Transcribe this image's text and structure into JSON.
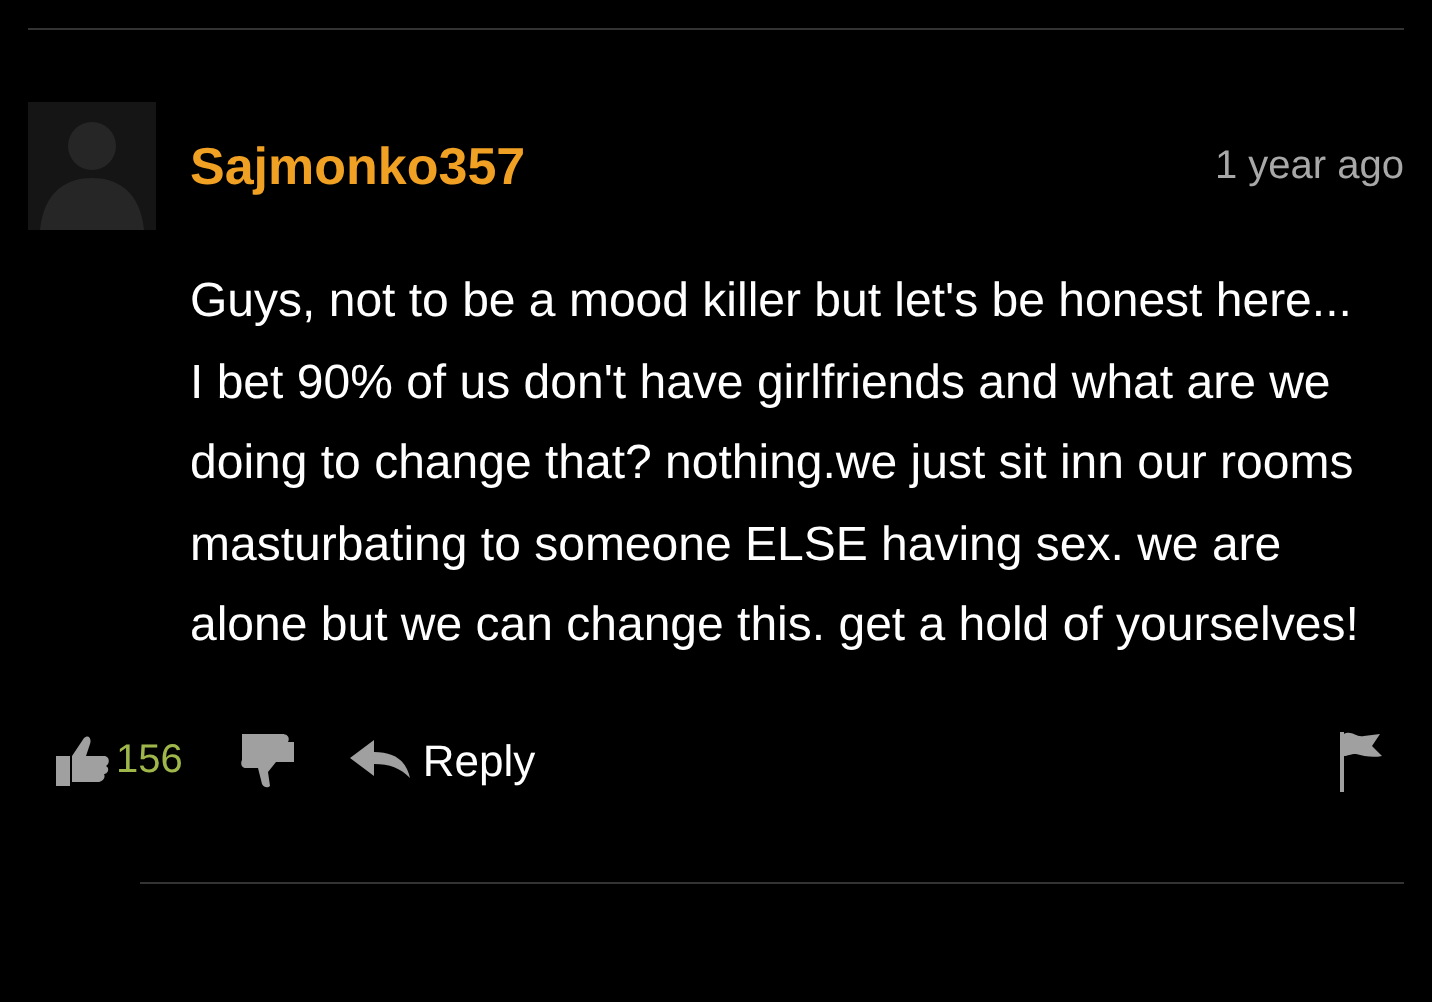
{
  "comment": {
    "username": "Sajmonko357",
    "time": "1 year ago",
    "text": "Guys, not to be a mood killer but let's be honest here... I bet 90% of us don't have girlfriends and what are we doing to change that? nothing.we just sit inn our rooms masturbating to someone ELSE having sex. we are alone but we can change this. get a hold of yourselves!",
    "likes": "156",
    "reply_label": "Reply"
  }
}
